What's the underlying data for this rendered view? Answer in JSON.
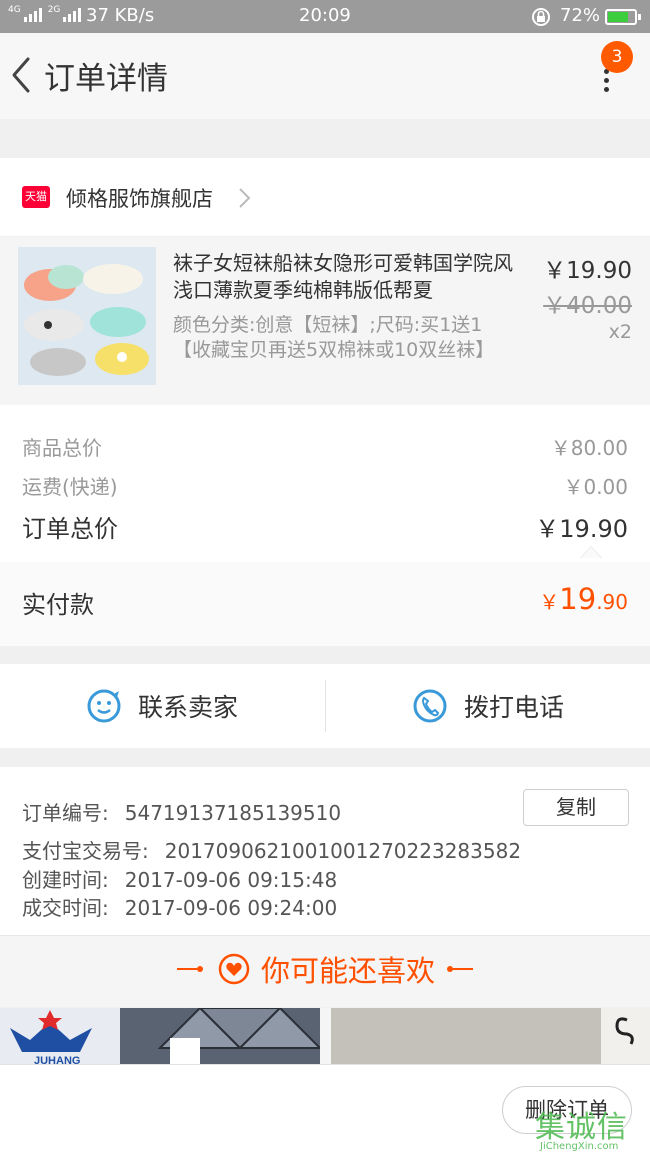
{
  "status_bar": {
    "network": "4G",
    "network2": "2G",
    "speed": "37 KB/s",
    "time": "20:09",
    "battery": "72%",
    "battery_level": 0.72
  },
  "header": {
    "title": "订单详情",
    "notification_count": "3"
  },
  "store": {
    "badge": "天猫",
    "name": "倾格服饰旗舰店"
  },
  "item": {
    "title": "袜子女短袜船袜女隐形可爱韩国学院风浅口薄款夏季纯棉韩版低帮夏",
    "spec": "颜色分类:创意【短袜】;尺码:买1送1【收藏宝贝再送5双棉袜或10双丝袜】",
    "price": "￥19.90",
    "original_price": "￥40.00",
    "quantity": "x2"
  },
  "summary": {
    "goods_total_label": "商品总价",
    "goods_total": "￥80.00",
    "shipping_label": "运费(快递)",
    "shipping": "￥0.00",
    "order_total_label": "订单总价",
    "order_total": "￥19.90",
    "paid_label": "实付款",
    "paid_currency": "￥",
    "paid_int": "19",
    "paid_dec": ".90"
  },
  "contact": {
    "seller_label": "联系卖家",
    "phone_label": "拨打电话"
  },
  "order_info": {
    "order_no_label": "订单编号:",
    "order_no": "54719137185139510",
    "copy_label": "复制",
    "alipay_label": "支付宝交易号:",
    "alipay_no": "2017090621001001270223283582",
    "created_label": "创建时间:",
    "created": "2017-09-06 09:15:48",
    "deal_label": "成交时间:",
    "deal": "2017-09-06 09:24:00"
  },
  "recommend": {
    "title": "你可能还喜欢",
    "brand_text": "JUHANG"
  },
  "bottom": {
    "delete_label": "删除订单"
  },
  "watermark": {
    "text": "集诚信",
    "sub": "JiChengXin.com"
  },
  "colors": {
    "accent": "#ff5000",
    "tmall": "#ff0036",
    "icon_blue": "#3a9ad9"
  }
}
